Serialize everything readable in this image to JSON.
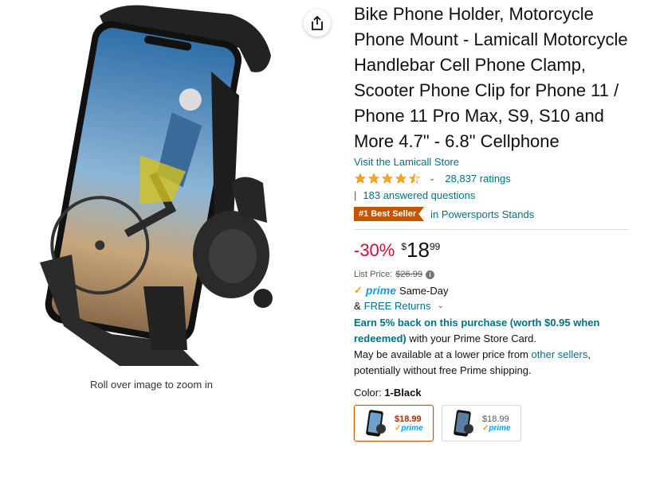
{
  "gallery": {
    "share_icon": "share-icon",
    "zoom_hint": "Roll over image to zoom in"
  },
  "product": {
    "title": "Bike Phone Holder, Motorcycle Phone Mount - Lamicall Motorcycle Handlebar Cell Phone Clamp, Scooter Phone Clip for Phone 11 / Phone 11 Pro Max, S9, S10 and More 4.7\" - 6.8\" Cellphone",
    "store_link": "Visit the Lamicall Store",
    "rating_stars": 4.5,
    "ratings_count": "28,837 ratings",
    "answered": "183 answered questions",
    "best_seller_badge": "#1 Best Seller",
    "best_seller_category": "in Powersports Stands"
  },
  "pricing": {
    "discount": "-30%",
    "currency": "$",
    "whole": "18",
    "fraction": "99",
    "list_price_label": "List Price:",
    "list_price": "$26.99",
    "prime_label": "prime",
    "delivery": "Same-Day",
    "returns_prefix": "&",
    "returns": "FREE Returns",
    "earn_bold": "Earn 5% back on this purchase (worth $0.95 when redeemed)",
    "earn_rest": " with your Prime Store Card.",
    "avail_prefix": "May be available at a lower price from ",
    "avail_link": "other sellers",
    "avail_suffix": ", potentially without free Prime shipping."
  },
  "variants": {
    "color_label": "Color:",
    "color_value": "1-Black",
    "options": [
      {
        "price": "$18.99",
        "prime": "prime",
        "selected": true
      },
      {
        "price": "$18.99",
        "prime": "prime",
        "selected": false
      }
    ]
  },
  "colors": {
    "link": "#007185",
    "discount": "#CC0C39",
    "badge": "#C45500",
    "prime_blue": "#1399FF",
    "star": "#FFA41C"
  }
}
